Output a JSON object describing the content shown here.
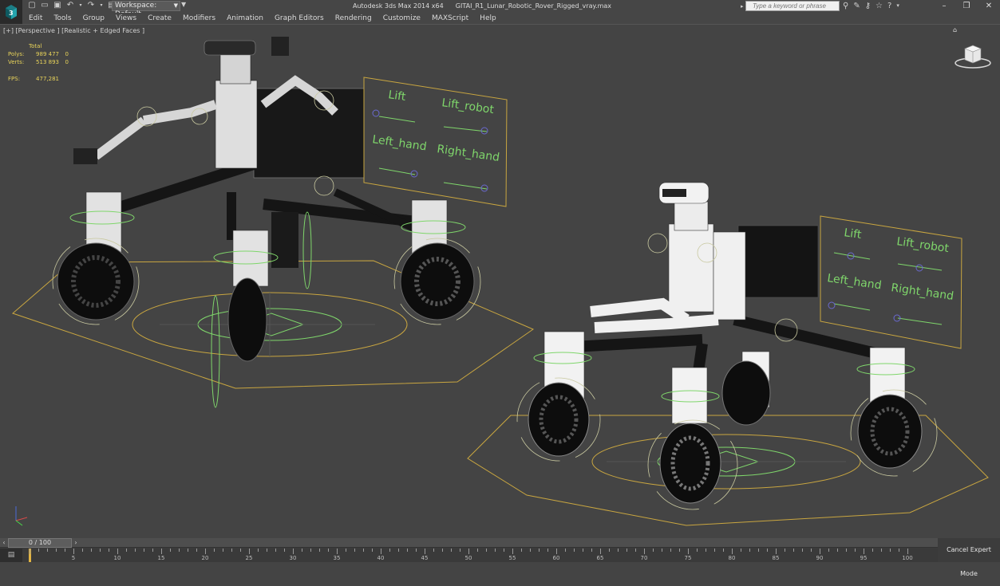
{
  "titlebar": {
    "app_title": "Autodesk 3ds Max  2014 x64",
    "file_name": "GITAI_R1_Lunar_Robotic_Rover_Rigged_vray.max",
    "workspace_label": "Workspace: Default",
    "search_placeholder": "Type a keyword or phrase"
  },
  "menu": {
    "items": [
      "Edit",
      "Tools",
      "Group",
      "Views",
      "Create",
      "Modifiers",
      "Animation",
      "Graph Editors",
      "Rendering",
      "Customize",
      "MAXScript",
      "Help"
    ]
  },
  "viewport": {
    "label": "[+] [Perspective ] [Realistic + Edged Faces ]",
    "stats": {
      "header": "Total",
      "polys_label": "Polys:",
      "polys_value": "989 477",
      "polys_sel": "0",
      "verts_label": "Verts:",
      "verts_value": "513 893",
      "verts_sel": "0",
      "fps_label": "FPS:",
      "fps_value": "477,281"
    },
    "panel_left": {
      "lift": "Lift",
      "lift_robot": "Lift_robot",
      "left_hand": "Left_hand",
      "right_hand": "Right_hand"
    },
    "panel_right": {
      "lift": "Lift",
      "lift_robot": "Lift_robot",
      "left_hand": "Left_hand",
      "right_hand": "Right_hand"
    },
    "colors": {
      "grid_outline": "#c9a640",
      "stats_text": "#e8d35a",
      "control_green": "#7fd66b"
    }
  },
  "timeline": {
    "frame_display": "0 / 100",
    "ticks": [
      "5",
      "10",
      "15",
      "20",
      "25",
      "30",
      "35",
      "40",
      "45",
      "50",
      "55",
      "60",
      "65",
      "70",
      "75",
      "80",
      "85",
      "90",
      "95",
      "100"
    ],
    "current_frame": 0
  },
  "status": {
    "cancel_expert": "Cancel Expert Mode"
  }
}
